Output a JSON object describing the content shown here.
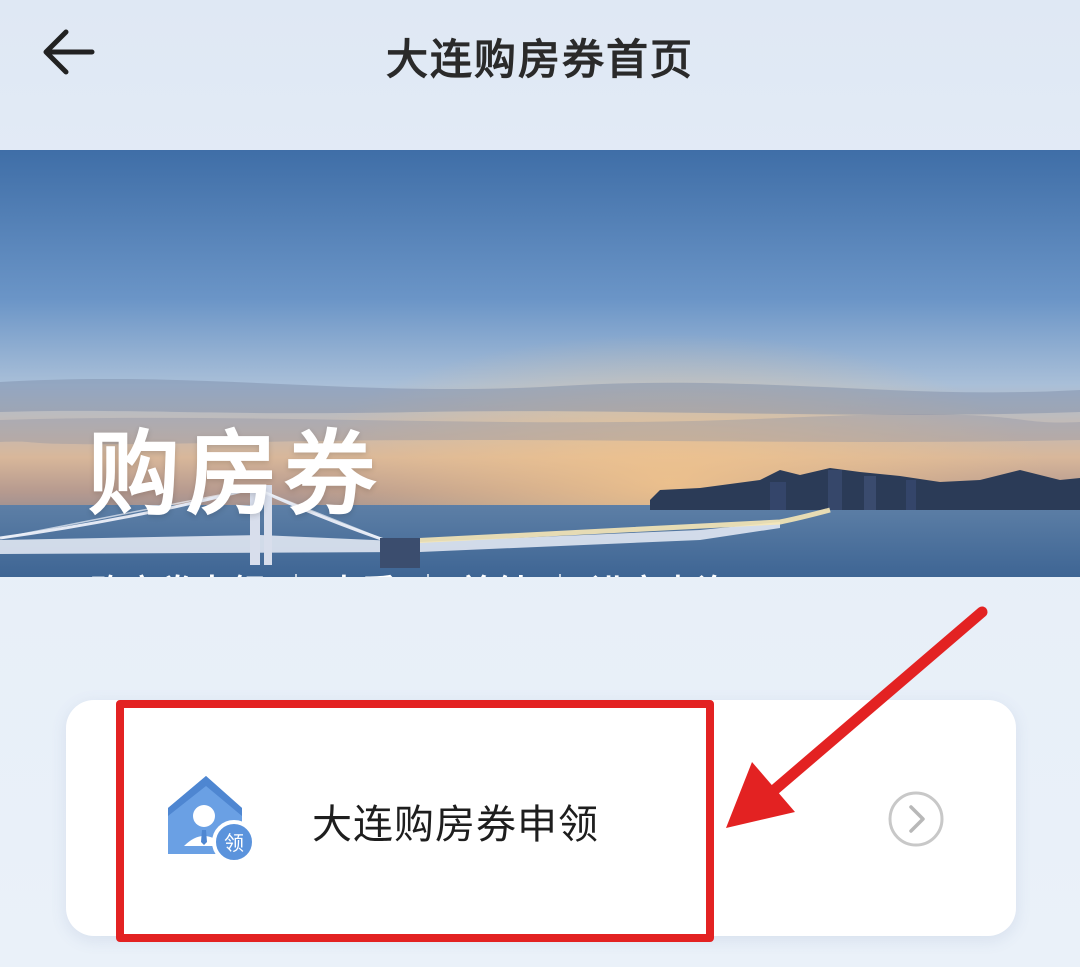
{
  "header": {
    "title": "大连购房券首页",
    "back_icon": "arrow-left-icon"
  },
  "banner": {
    "title": "购房券",
    "nav_items": [
      "购房券申领",
      "查看",
      "兑付",
      "进度查询"
    ]
  },
  "card": {
    "label": "大连购房券申领",
    "icon": "house-user-icon",
    "icon_badge": "领",
    "arrow_icon": "chevron-right-circle-icon"
  },
  "colors": {
    "highlight": "#e32222",
    "icon_blue": "#5b93dc",
    "title_text": "#2a2a2a"
  }
}
